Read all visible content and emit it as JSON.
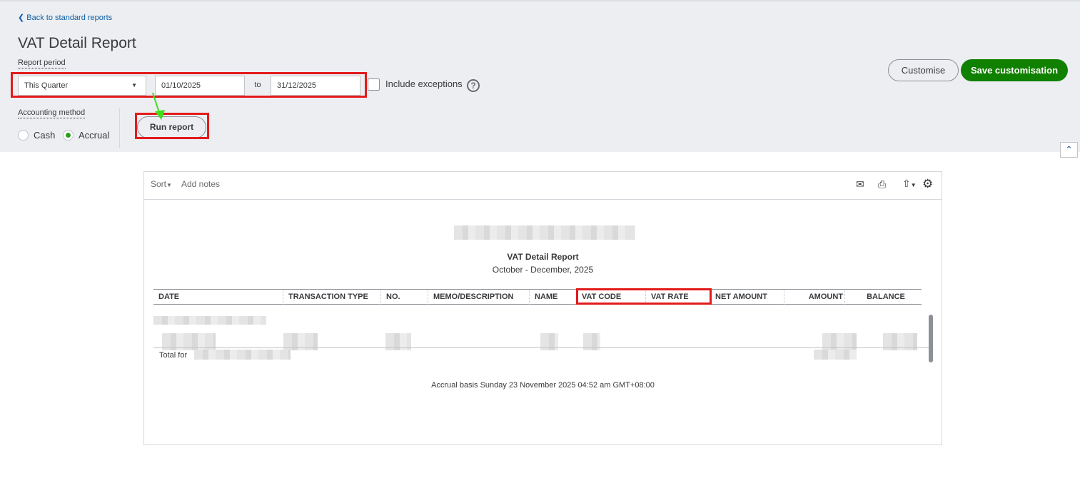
{
  "header": {
    "back_link": "Back to standard reports",
    "title": "VAT Detail Report",
    "report_period_label": "Report period",
    "period_select": "This Quarter",
    "date_from": "01/10/2025",
    "to_label": "to",
    "date_to": "31/12/2025",
    "include_exceptions": "Include exceptions",
    "accounting_method_label": "Accounting method",
    "cash": "Cash",
    "accrual": "Accrual",
    "selected_method": "Accrual",
    "run_report": "Run report",
    "customise": "Customise",
    "save_customisation": "Save customisation"
  },
  "report": {
    "sort": "Sort",
    "add_notes": "Add notes",
    "title": "VAT Detail Report",
    "subtitle": "October - December, 2025",
    "columns": [
      "DATE",
      "TRANSACTION TYPE",
      "NO.",
      "MEMO/DESCRIPTION",
      "NAME",
      "VAT CODE",
      "VAT RATE",
      "NET AMOUNT",
      "AMOUNT",
      "BALANCE"
    ],
    "total_prefix": "Total for",
    "footer": "Accrual basis  Sunday 23 November 2025  04:52 am GMT+08:00"
  },
  "colors": {
    "accent_green": "#108000",
    "link_blue": "#0d5fa6",
    "highlight_red": "#e31b1b"
  }
}
